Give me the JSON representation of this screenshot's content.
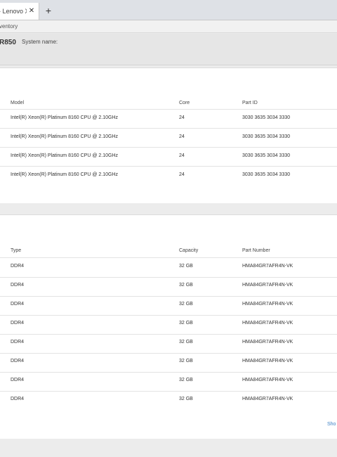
{
  "browser": {
    "tab_title": "- Lenovo X",
    "tab_close": "✕",
    "new_tab": "+"
  },
  "breadcrumb": "ventory",
  "system": {
    "model": "R850",
    "name_label": "System name:"
  },
  "processors": {
    "columns": [
      "Model",
      "Core",
      "Part ID"
    ],
    "rows": [
      [
        "Intel(R) Xeon(R) Platinum 8160 CPU @ 2.10GHz",
        "24",
        "3030 3635 3034 3330"
      ],
      [
        "Intel(R) Xeon(R) Platinum 8160 CPU @ 2.10GHz",
        "24",
        "3030 3635 3034 3330"
      ],
      [
        "Intel(R) Xeon(R) Platinum 8160 CPU @ 2.10GHz",
        "24",
        "3030 3635 3034 3330"
      ],
      [
        "Intel(R) Xeon(R) Platinum 8160 CPU @ 2.10GHz",
        "24",
        "3030 3635 3034 3330"
      ]
    ]
  },
  "memory": {
    "columns": [
      "Type",
      "Capacity",
      "Part Number"
    ],
    "rows": [
      [
        "DDR4",
        "32 GB",
        "HMA84GR7AFR4N-VK"
      ],
      [
        "DDR4",
        "32 GB",
        "HMA84GR7AFR4N-VK"
      ],
      [
        "DDR4",
        "32 GB",
        "HMA84GR7AFR4N-VK"
      ],
      [
        "DDR4",
        "32 GB",
        "HMA84GR7AFR4N-VK"
      ],
      [
        "DDR4",
        "32 GB",
        "HMA84GR7AFR4N-VK"
      ],
      [
        "DDR4",
        "32 GB",
        "HMA84GR7AFR4N-VK"
      ],
      [
        "DDR4",
        "32 GB",
        "HMA84GR7AFR4N-VK"
      ],
      [
        "DDR4",
        "32 GB",
        "HMA84GR7AFR4N-VK"
      ]
    ],
    "show_link": "Sho"
  }
}
